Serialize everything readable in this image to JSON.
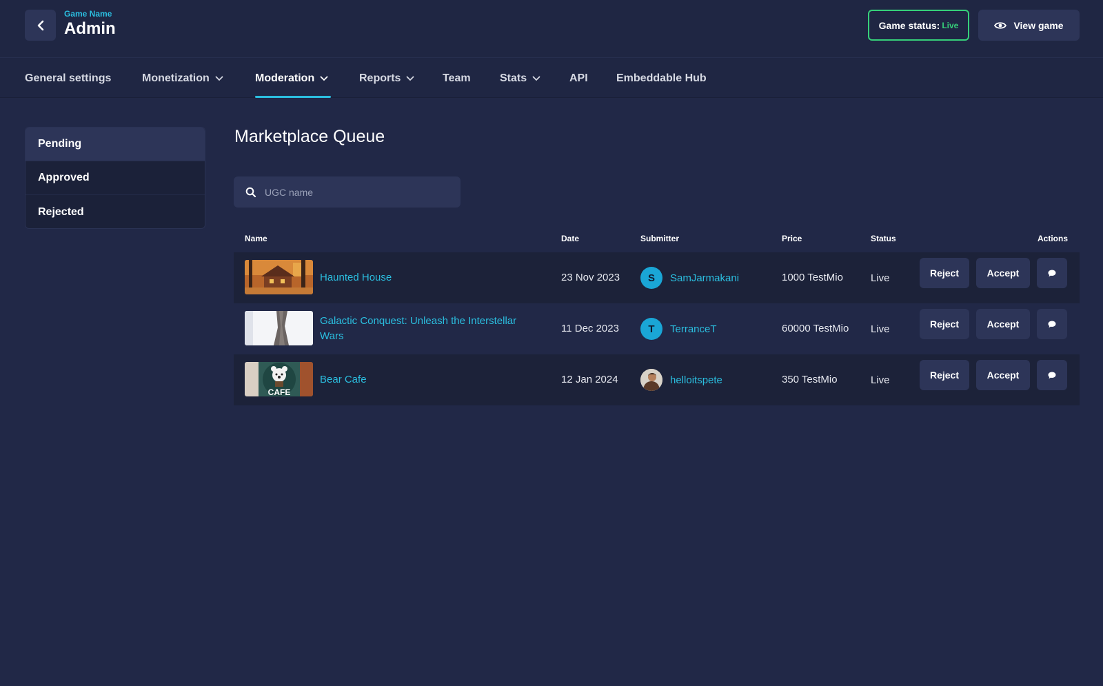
{
  "header": {
    "game_name": "Game Name",
    "title": "Admin",
    "status_label": "Game status:",
    "status_value": "Live",
    "view_game_label": "View game",
    "status_color": "#36d07a",
    "accent_color": "#2bbfe0"
  },
  "nav": {
    "items": [
      {
        "label": "General settings",
        "dropdown": false
      },
      {
        "label": "Monetization",
        "dropdown": true
      },
      {
        "label": "Moderation",
        "dropdown": true,
        "active": true
      },
      {
        "label": "Reports",
        "dropdown": true
      },
      {
        "label": "Team",
        "dropdown": false
      },
      {
        "label": "Stats",
        "dropdown": true
      },
      {
        "label": "API",
        "dropdown": false
      },
      {
        "label": "Embeddable Hub",
        "dropdown": false
      }
    ]
  },
  "sidebar": {
    "items": [
      {
        "label": "Pending",
        "active": true
      },
      {
        "label": "Approved"
      },
      {
        "label": "Rejected"
      }
    ]
  },
  "main": {
    "title": "Marketplace Queue",
    "search": {
      "placeholder": "UGC name",
      "value": ""
    },
    "table": {
      "columns": [
        "Name",
        "Date",
        "Submitter",
        "Price",
        "Status",
        "Actions"
      ],
      "rows": [
        {
          "name": "Haunted House",
          "date": "23 Nov 2023",
          "submitter": "SamJarmakani",
          "avatar_initial": "S",
          "price": "1000 TestMio",
          "status": "Live",
          "thumb": "cabin-autumn-thumbnail"
        },
        {
          "name": "Galactic Conquest: Unleash the Interstellar Wars",
          "date": "11 Dec 2023",
          "submitter": "TerranceT",
          "avatar_initial": "T",
          "price": "60000 TestMio",
          "status": "Live",
          "thumb": "tree-trunk-thumbnail"
        },
        {
          "name": "Bear Cafe",
          "date": "12 Jan 2024",
          "submitter": "helloitspete",
          "avatar_initial": "",
          "price": "350 TestMio",
          "status": "Live",
          "thumb": "bear-cafe-thumbnail",
          "thumb_text": "CAFE"
        }
      ],
      "actions": {
        "reject_label": "Reject",
        "accept_label": "Accept",
        "comment_icon": "comment-icon"
      }
    }
  }
}
